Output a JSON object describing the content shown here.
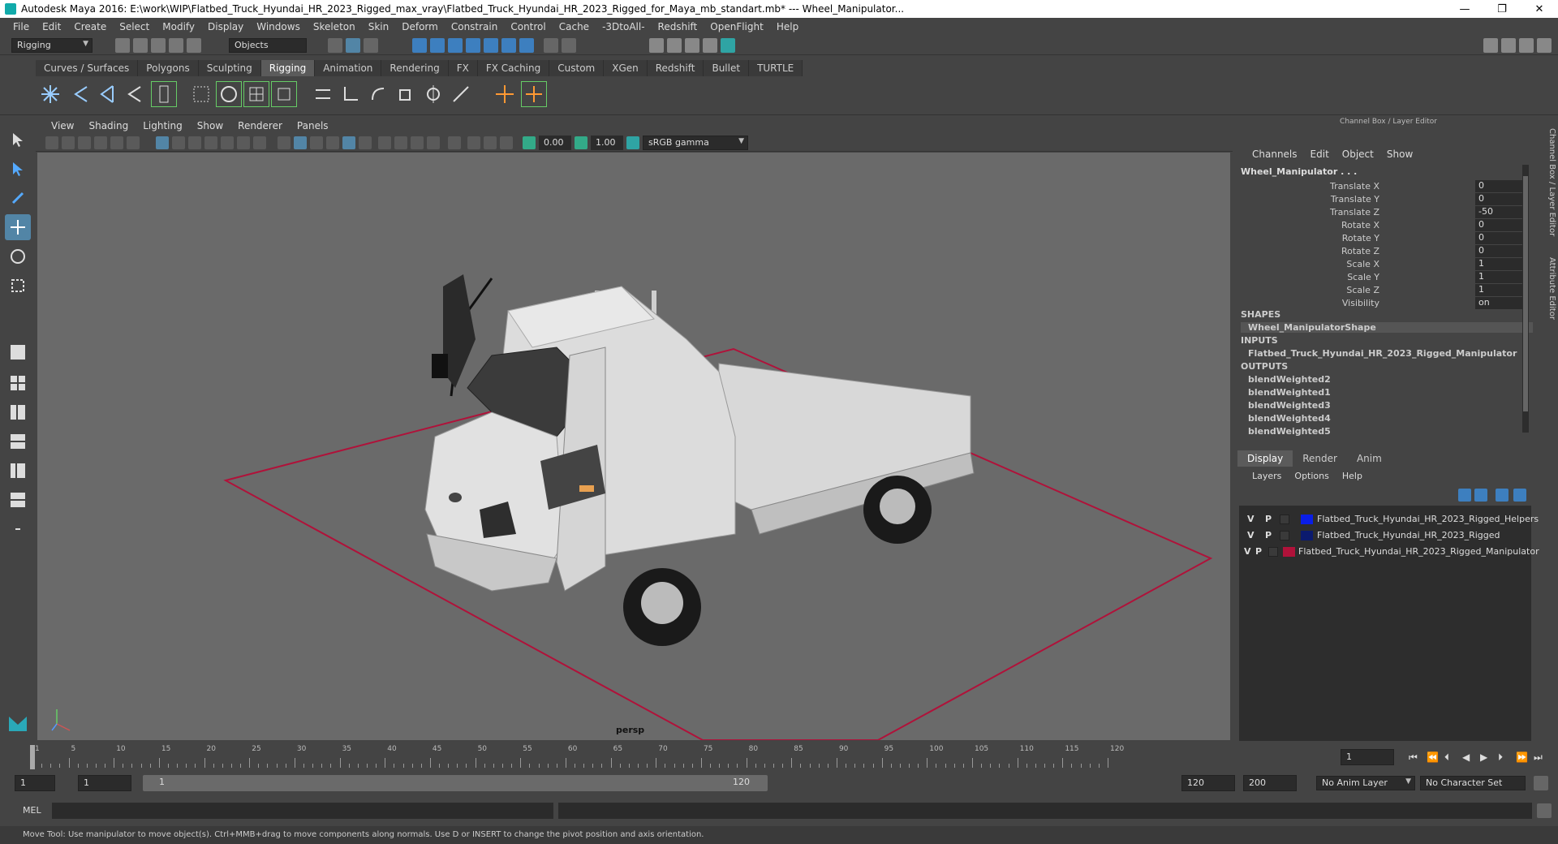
{
  "window": {
    "title": "Autodesk Maya 2016: E:\\work\\WIP\\Flatbed_Truck_Hyundai_HR_2023_Rigged_max_vray\\Flatbed_Truck_Hyundai_HR_2023_Rigged_for_Maya_mb_standart.mb*   ---   Wheel_Manipulator...",
    "minimize": "—",
    "restore": "❐",
    "close": "✕"
  },
  "menubar": [
    "File",
    "Edit",
    "Create",
    "Select",
    "Modify",
    "Display",
    "Windows",
    "Skeleton",
    "Skin",
    "Deform",
    "Constrain",
    "Control",
    "Cache",
    "-3DtoAll-",
    "Redshift",
    "OpenFlight",
    "Help"
  ],
  "statusline": {
    "menuset": "Rigging",
    "select_mode": "Objects"
  },
  "shelf": {
    "tabs": [
      "Curves / Surfaces",
      "Polygons",
      "Sculpting",
      "Rigging",
      "Animation",
      "Rendering",
      "FX",
      "FX Caching",
      "Custom",
      "XGen",
      "Redshift",
      "Bullet",
      "TURTLE"
    ],
    "active_tab": "Rigging"
  },
  "viewport": {
    "menus": [
      "View",
      "Shading",
      "Lighting",
      "Show",
      "Renderer",
      "Panels"
    ],
    "exposure": "0.00",
    "gamma": "1.00",
    "colorspace": "sRGB gamma",
    "camera_label": "persp"
  },
  "channelbox": {
    "header": "Channel Box / Layer Editor",
    "menus": [
      "Channels",
      "Edit",
      "Object",
      "Show"
    ],
    "object_name": "Wheel_Manipulator . . .",
    "attributes": [
      {
        "name": "Translate X",
        "value": "0"
      },
      {
        "name": "Translate Y",
        "value": "0"
      },
      {
        "name": "Translate Z",
        "value": "-50"
      },
      {
        "name": "Rotate X",
        "value": "0"
      },
      {
        "name": "Rotate Y",
        "value": "0"
      },
      {
        "name": "Rotate Z",
        "value": "0"
      },
      {
        "name": "Scale X",
        "value": "1"
      },
      {
        "name": "Scale Y",
        "value": "1"
      },
      {
        "name": "Scale Z",
        "value": "1"
      },
      {
        "name": "Visibility",
        "value": "on"
      }
    ],
    "shapes_label": "SHAPES",
    "shapes": [
      "Wheel_ManipulatorShape"
    ],
    "inputs_label": "INPUTS",
    "inputs": [
      "Flatbed_Truck_Hyundai_HR_2023_Rigged_Manipulator"
    ],
    "outputs_label": "OUTPUTS",
    "outputs": [
      "blendWeighted2",
      "blendWeighted1",
      "blendWeighted3",
      "blendWeighted4",
      "blendWeighted5"
    ]
  },
  "layer_editor": {
    "tabs": [
      "Display",
      "Render",
      "Anim"
    ],
    "active_tab": "Display",
    "menus": [
      "Layers",
      "Options",
      "Help"
    ],
    "layers": [
      {
        "v": "V",
        "p": "P",
        "color": "#0a1ee6",
        "name": "Flatbed_Truck_Hyundai_HR_2023_Rigged_Helpers"
      },
      {
        "v": "V",
        "p": "P",
        "color": "#0b1a6e",
        "name": "Flatbed_Truck_Hyundai_HR_2023_Rigged"
      },
      {
        "v": "V",
        "p": "P",
        "color": "#b0123a",
        "name": "Flatbed_Truck_Hyundai_HR_2023_Rigged_Manipulator"
      }
    ]
  },
  "side_tabs": [
    "Channel Box / Layer Editor",
    "Attribute Editor"
  ],
  "timeline": {
    "ticks": [
      "1",
      "5",
      "10",
      "15",
      "20",
      "25",
      "30",
      "35",
      "40",
      "45",
      "50",
      "55",
      "60",
      "65",
      "70",
      "75",
      "80",
      "85",
      "90",
      "95",
      "100",
      "105",
      "110",
      "115",
      "120"
    ],
    "current_frame": "1"
  },
  "range": {
    "start": "1",
    "playback_start": "1",
    "bar_start": "1",
    "bar_end": "120",
    "playback_end": "120",
    "end": "200",
    "anim_layer": "No Anim Layer",
    "character_set": "No Character Set"
  },
  "cmdline": {
    "label": "MEL"
  },
  "helpline": {
    "text": "Move Tool: Use manipulator to move object(s). Ctrl+MMB+drag to move components along normals. Use D or INSERT to change the pivot position and axis orientation."
  }
}
